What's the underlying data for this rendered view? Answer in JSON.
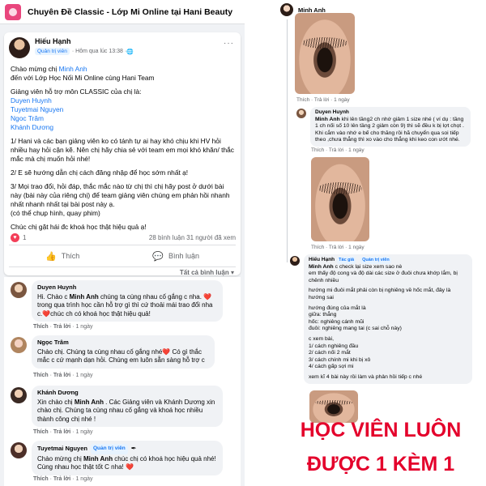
{
  "group": {
    "title": "Chuyên Đề Classic - Lớp Mi Online tại Hani Beauty"
  },
  "post": {
    "author": "Hiếu Hạnh",
    "role": "Quản trị viên",
    "time": "· Hôm qua lúc 13:38 · ",
    "more": "···",
    "greeting_1": "Chào mừng chị ",
    "greeting_name": "Minh Anh",
    "greeting_2": "đến với Lớp Học Nối Mi Online cùng Hani Team",
    "instructors_intro": "Giảng viên hỗ trợ môn CLASSIC của chị là:",
    "instructors": [
      "Duyen Huynh",
      "Tuyetmai Nguyen",
      "Ngoc Trâm",
      "Khánh Dương"
    ],
    "point_1": "1/ Hani và các bạn giảng viên ko có tánh tự ai hay khó chịu khi HV hỏi nhiều hay hỏi cận kẽ. Nên chị hãy chia sẻ với team em mọi khó khăn/ thắc mắc mà chị muốn hỏi nhé!",
    "point_2": "2/ E sẽ hướng dẫn chị cách đăng nhập để học sớm nhất ạ!",
    "point_3": "3/ Mọi trao đổi, hỏi đáp, thắc mắc nào từ chị thì chị hãy post ở dưới bài này (bài này của riêng chị) để team giảng viên chúng em phản hồi nhanh nhất nhanh nhất tại bài post này ạ.",
    "point_3b": "(có thể chụp hình, quay phim)",
    "closing": "Chúc chị gặt hái đc khoá học thật hiệu quả ạ!",
    "reactions_count": "1",
    "stats": "28 bình luận  31 người đã xem",
    "like_label": "Thích",
    "comment_label": "Bình luận",
    "filter_label": "Tất cả bình luận ▾"
  },
  "comments": [
    {
      "name": "Duyen Huynh",
      "text_1": "Hi. Chào c ",
      "bold": "Minh Anh",
      "text_2": " chúng ta cùng nhau cố gắng c nha.",
      "text_3": "❤️trong qua trình học cần hỗ trợ gì thì cứ thoải mái trao đổi nha c.❤️chúc ch có khoá học thật hiệu quả!",
      "meta_like": "Thích",
      "meta_reply": "Trả lời",
      "meta_time": "1 ngày"
    },
    {
      "name": "Ngọc Trâm",
      "text_1": "Chào chị. Chúng ta cùng nhau cố gắng nhé❤️ Có gì thắc mắc c cứ mạnh dạn hỏi. Chúng em luôn sẵn sàng hỗ trợ c",
      "meta_like": "Thích",
      "meta_reply": "Trả lời",
      "meta_time": "1 ngày"
    },
    {
      "name": "Khánh Dương",
      "text_1": "Xin chào chị ",
      "bold": "Minh Anh",
      "text_2": " . Các Giảng viên và Khánh Dương xin chào chị. Chúng ta cùng nhau cố gắng và khoá học nhiều thành công chị nhé !",
      "meta_like": "Thích",
      "meta_reply": "Trả lời",
      "meta_time": "1 ngày"
    },
    {
      "name": "Tuyetmai Nguyen",
      "role": "Quản trị viên",
      "text_1": "Chào mừng chị ",
      "bold": "Minh Anh",
      "text_2": " chúc chị có khoá học hiệu quả nhé! Cùng nhau học thật tốt C nha! ❤️",
      "meta_like": "Thích",
      "meta_reply": "Trả lời",
      "meta_time": "1 ngày"
    }
  ],
  "right": {
    "top_name": "Minh Anh",
    "meta_1": "Thích · Trả lời · 1 ngày",
    "reply_1": {
      "name": "Duyen Huynh",
      "bold": "Minh Anh",
      "text_1": " khi lên tầng2 ch nhớ giảm 1 size nhé ( ví dụ : tầng 1 ch nối số 10 lên tầng 2 giảm còn 9) thì sẽ đều k bị lợt chọt .",
      "text_2": "Khi cắm vào nhớ e bế cho thăng rồi hã chuyển qua soi tiếp theo ,chưa thẳng thì xo vào cho thẳng khi keo con ướt nhé."
    },
    "meta_2": "Thích · Trả lời · 1 ngày",
    "meta_3": "Thích · Trả lời · 1 ngày",
    "reply_2": {
      "name": "Hiếu Hạnh",
      "role_1": "Tác giả",
      "role_2": "Quản trị viên",
      "bold": "Minh Anh",
      "lines": [
        " c check lại size xem sao nè",
        "em thấy độ cong và độ dài các size ở đuôi chưa khớp lắm, bị chênh nhiều",
        "hướng mi đuôi mắt phải còn bị nghiêng về hốc mắt, đây là hướng sai",
        "hướng đúng của mắt là",
        "giữa: thẳng",
        "hốc: nghiêng cánh mũi",
        "đuôi: nghiêng mang tai (c sai chỗ này)",
        "c xem bài,",
        "1/ cách nghiêng đầu",
        "2/ cách nối 2 mắt",
        "3/ cách chính mi khi bị xô",
        "4/ cách gấp sợi mi",
        "xem kĩ 4 bài này rồi làm và phản hồi tiếp c nhé"
      ]
    },
    "big_text_line_1": "HỌC VIÊN LUÔN",
    "big_text_line_2": "ĐƯỢC 1 KÈM 1"
  }
}
